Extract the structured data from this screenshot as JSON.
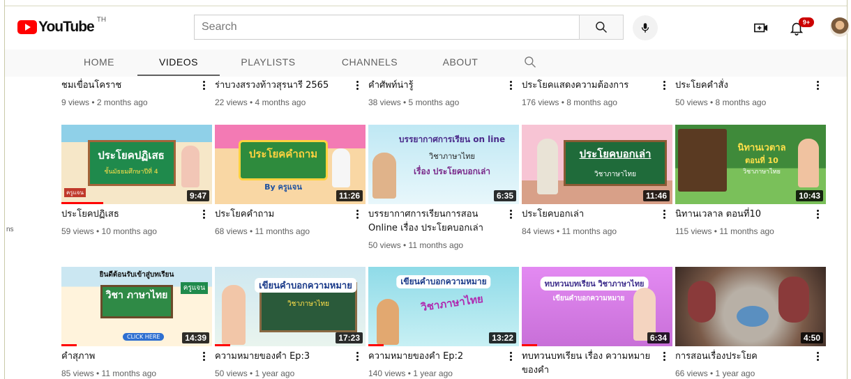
{
  "masthead": {
    "logo_text": "YouTube",
    "logo_country": "TH",
    "search_placeholder": "Search",
    "notification_badge": "9+",
    "icons": [
      "youtube-logo-icon",
      "search-icon",
      "mic-icon",
      "create-video-icon",
      "bell-icon",
      "avatar"
    ]
  },
  "side_hint": "ns",
  "tabs": [
    {
      "label": "HOME",
      "active": false
    },
    {
      "label": "VIDEOS",
      "active": true
    },
    {
      "label": "PLAYLISTS",
      "active": false
    },
    {
      "label": "CHANNELS",
      "active": false
    },
    {
      "label": "ABOUT",
      "active": false
    }
  ],
  "row0": [
    {
      "title": "ชมเขื่อนโคราช",
      "views": "9 views • 2 months ago"
    },
    {
      "title": "ร่าบวงสรวงท้าวสุรนารี 2565",
      "views": "22 views • 4 months ago"
    },
    {
      "title": "คำศัพท์น่ารู้",
      "views": "38 views • 5 months ago"
    },
    {
      "title": "ประโยคแสดงความต้องการ",
      "views": "176 views • 8 months ago"
    },
    {
      "title": "ประโยคคำสั่ง",
      "views": "50 views • 8 months ago"
    }
  ],
  "row1": [
    {
      "title": "ประโยคปฏิเสธ",
      "views": "59 views • 10 months ago",
      "duration": "9:47",
      "thumb_title": "ประโยคปฏิเสธ",
      "thumb_sub": "ชั้นมัธยมศึกษาปีที่ 4",
      "thumb_corner": "ครูแจน"
    },
    {
      "title": "ประโยคคำถาม",
      "views": "68 views • 11 months ago",
      "duration": "11:26",
      "thumb_title": "ประโยคคำถาม",
      "thumb_sub": "By ครูแจน",
      "thumb_corner": ""
    },
    {
      "title": "บรรยากาศการเรียนการสอน Online เรื่อง ประโยคบอกเล่า",
      "views": "50 views • 11 months ago",
      "duration": "6:35",
      "thumb_title": "บรรยากาศการเรียน on line",
      "thumb_sub": "วิชาภาษาไทย",
      "thumb_line3": "เรื่อง ประโยคบอกเล่า"
    },
    {
      "title": "ประโยคบอกเล่า",
      "views": "84 views • 11 months ago",
      "duration": "11:46",
      "thumb_title": "ประโยคบอกเล่า",
      "thumb_sub": "วิชาภาษาไทย"
    },
    {
      "title": "นิทานเวลาล ตอนที่10",
      "views": "115 views • 11 months ago",
      "duration": "10:43",
      "thumb_title": "นิทานเวตาล",
      "thumb_sub": "ตอนที่ 10",
      "thumb_line3": "วิชาภาษาไทย"
    }
  ],
  "row2": [
    {
      "title": "คำสุภาพ",
      "views": "85 views • 11 months ago",
      "duration": "14:39",
      "thumb_title": "วิชา ภาษาไทย",
      "thumb_sub": "ยินดีต้อนรับเข้าสู่บทเรียน",
      "thumb_line3": "CLICK HERE",
      "thumb_corner": "ครูแจน"
    },
    {
      "title": "ความหมายของคำ Ep:3",
      "views": "50 views • 1 year ago",
      "duration": "17:23",
      "thumb_title": "เขียนคำบอกความหมาย",
      "thumb_sub": "วิชาภาษาไทย"
    },
    {
      "title": "ความหมายของคำ Ep:2",
      "views": "140 views • 1 year ago",
      "duration": "13:22",
      "thumb_title": "เขียนคำบอกความหมาย",
      "thumb_sub": "วิชาภาษาไทย"
    },
    {
      "title": "ทบทวนบทเรียน เรื่อง ความหมายของคำ",
      "views": "",
      "duration": "6:34",
      "thumb_title": "ทบทวนบทเรียน วิชาภาษาไทย",
      "thumb_sub": "เขียนคำบอกความหมาย"
    },
    {
      "title": "การสอนเรื่องประโยค",
      "views": "66 views • 1 year ago",
      "duration": "4:50"
    }
  ],
  "colors": {
    "brand_red": "#ff0000",
    "tabs_bg": "#f9f9f9",
    "secondary_text": "#606060"
  }
}
